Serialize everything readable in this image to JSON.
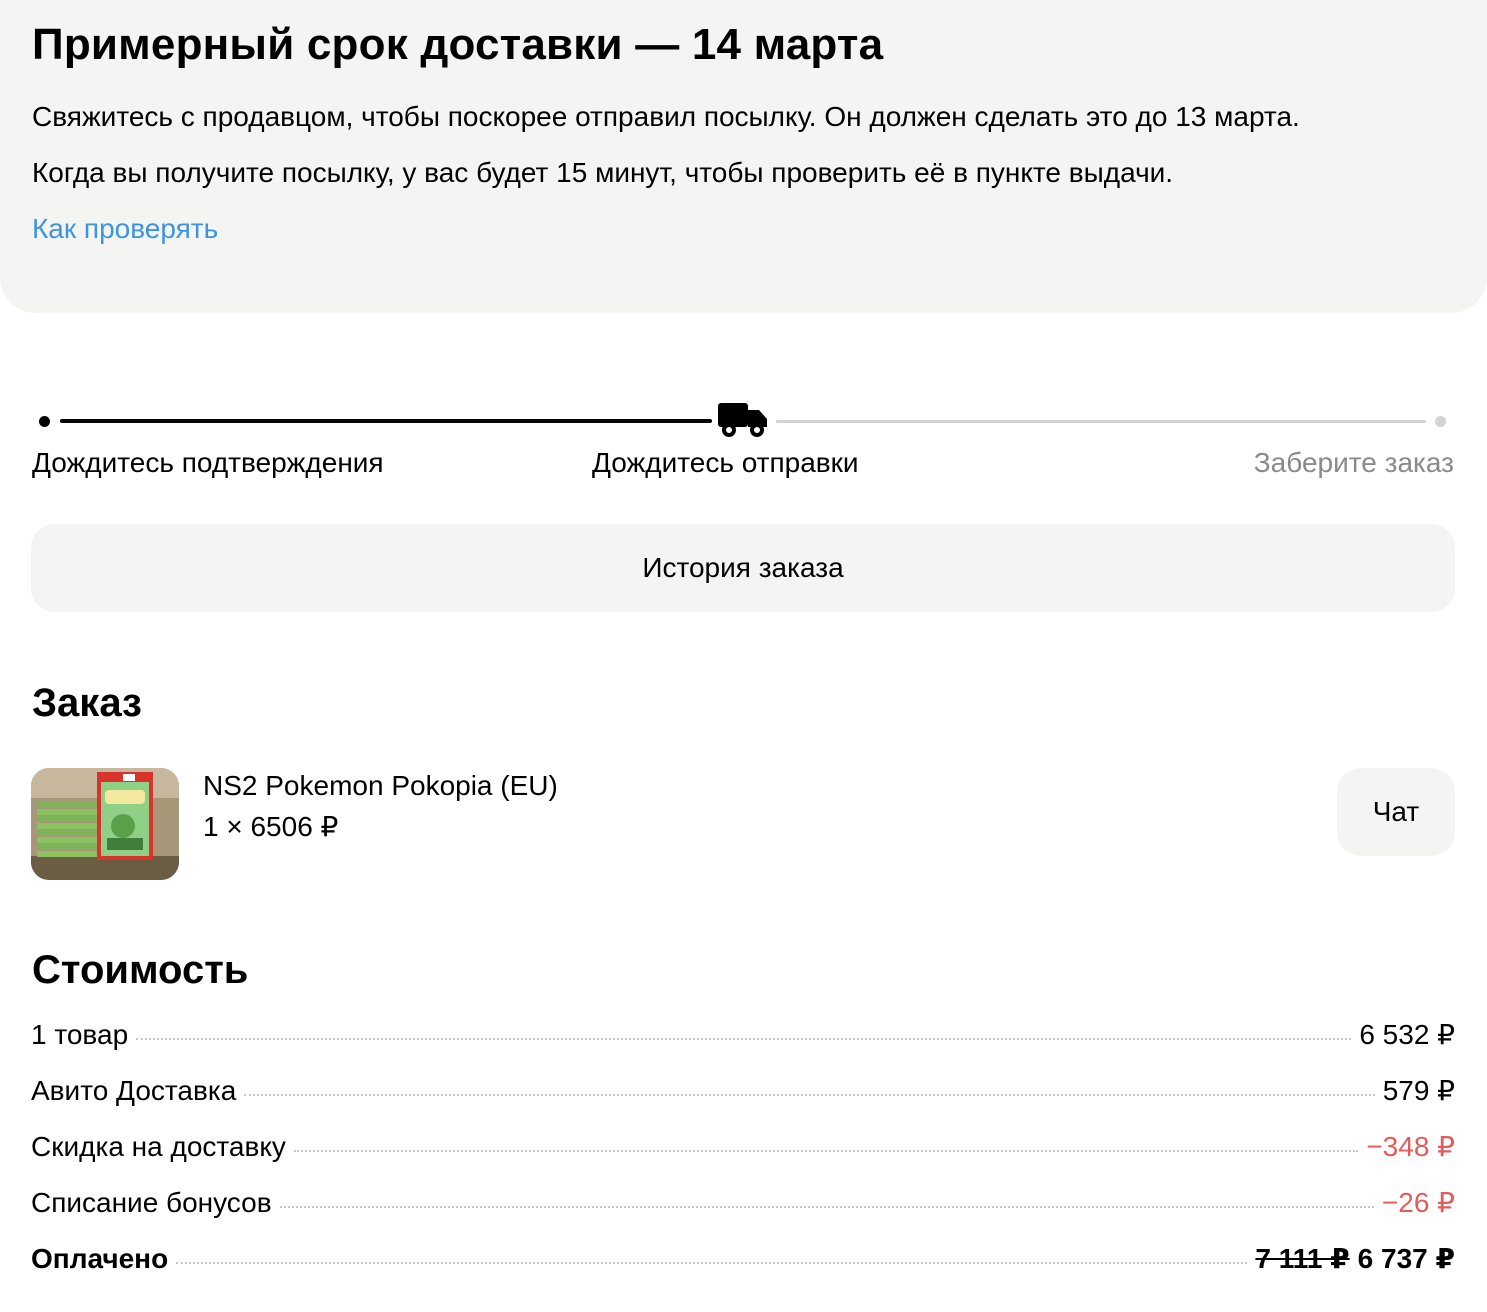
{
  "delivery": {
    "title": "Примерный срок доставки — 14 марта",
    "line1": "Свяжитесь с продавцом, чтобы поскорее отправил посылку. Он должен сделать это до 13 марта.",
    "line2": "Когда вы получите посылку, у вас будет 15 минут, чтобы проверить её в пункте выдачи.",
    "link": "Как проверять",
    "link_color": "#3d94e0"
  },
  "progress": {
    "steps": [
      {
        "label": "Дождитесь подтверждения",
        "state": "done"
      },
      {
        "label": "Дождитесь отправки",
        "state": "current",
        "icon": "truck-icon"
      },
      {
        "label": "Заберите заказ",
        "state": "pending"
      }
    ]
  },
  "history_button": "История заказа",
  "order": {
    "title": "Заказ",
    "item": {
      "name": "NS2 Pokemon Pokopia (EU)",
      "price": "1 × 6506 ₽"
    },
    "chat_button": "Чат"
  },
  "cost": {
    "title": "Стоимость",
    "rows": [
      {
        "label": "1 товар",
        "value": "6 532 ₽"
      },
      {
        "label": "Авито Доставка",
        "value": "579 ₽"
      },
      {
        "label": "Скидка на доставку",
        "value": "−348 ₽"
      },
      {
        "label": "Списание бонусов",
        "value": "−26 ₽"
      }
    ],
    "total": {
      "label": "Оплачено",
      "old_value": "7 111 ₽",
      "value": "6 737 ₽"
    },
    "negative_color": "#e25c5c"
  }
}
